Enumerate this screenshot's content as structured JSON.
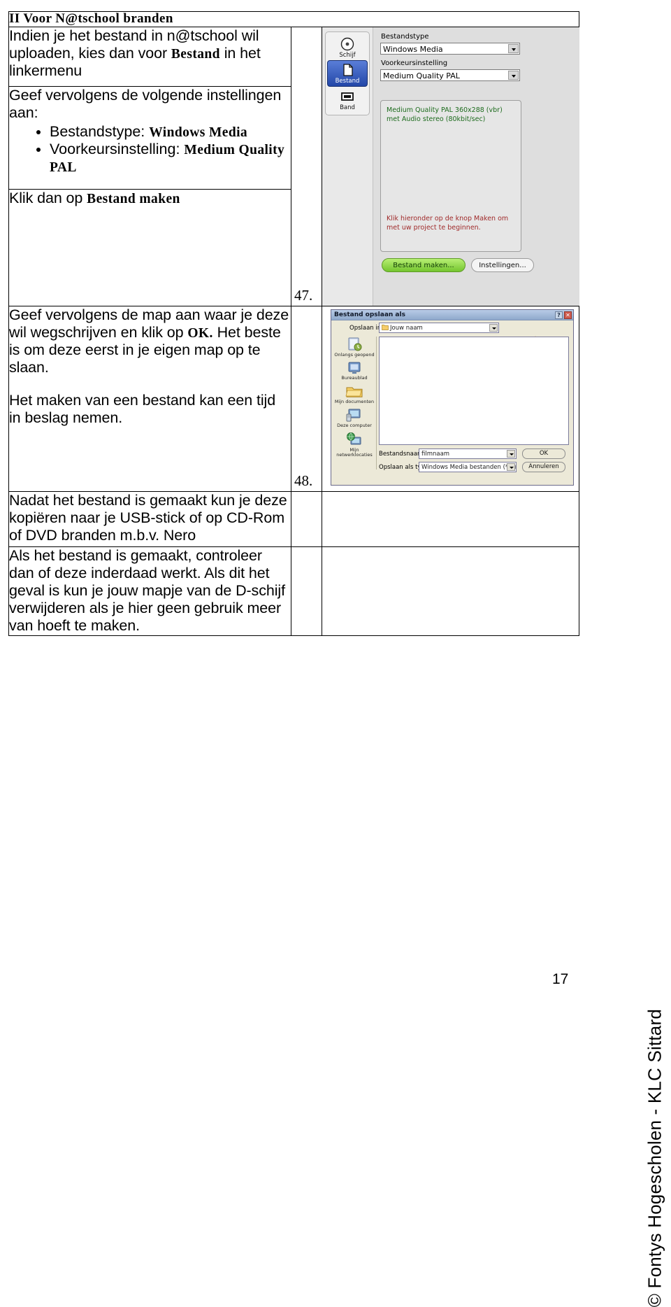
{
  "document": {
    "page_number": "17",
    "copyright": "© Fontys Hogescholen - KLC Sittard"
  },
  "table": {
    "header": "II Voor N@tschool branden",
    "rows": [
      {
        "id": "row-upload",
        "text_plain_1": "Indien je het bestand in n@tschool wil uploaden, kies dan voor ",
        "text_bold_1": "Bestand",
        "text_plain_2": " in het linkermenu"
      },
      {
        "id": "row-settings",
        "intro": "Geef vervolgens de volgende instellingen aan:",
        "bullets": [
          {
            "label": "Bestandstype: ",
            "value": "Windows Media"
          },
          {
            "label": "Voorkeursinstelling: ",
            "value": "Medium Quality PAL"
          }
        ]
      },
      {
        "id": "row-make",
        "text_plain_1": "Klik dan op ",
        "text_bold_1": "Bestand maken"
      },
      {
        "id": "row-folder",
        "text_plain_1": "Geef vervolgens de map aan waar je deze wil wegschrijven en klik op ",
        "text_bold_1": "OK.",
        "text_plain_2": " Het beste is om deze eerst in je eigen map op te slaan.",
        "paragraph_2": "Het maken van een bestand kan een tijd in beslag nemen."
      },
      {
        "id": "row-copy",
        "text_plain_1": "Nadat het bestand is gemaakt kun je deze kopiëren naar je USB-stick of op CD-Rom of DVD branden m.b.v. Nero"
      },
      {
        "id": "row-verify",
        "text_plain_1": "Als het bestand is gemaakt, controleer dan of deze inderdaad werkt. Als dit het geval is kun je jouw mapje van de D-schijf verwijderen als je hier geen gebruik meer van hoeft te maken."
      }
    ],
    "figure_numbers": {
      "first": "47.",
      "second": "48."
    }
  },
  "screenshot_nero": {
    "tabs": [
      {
        "name": "Schijf",
        "icon": "disc-icon",
        "selected": false
      },
      {
        "name": "Bestand",
        "icon": "file-icon",
        "selected": true
      },
      {
        "name": "Band",
        "icon": "tape-icon",
        "selected": false
      }
    ],
    "field_type_label": "Bestandstype",
    "field_type_value": "Windows Media",
    "field_preset_label": "Voorkeursinstelling",
    "field_preset_value": "Medium Quality PAL",
    "info_green": "Medium Quality PAL 360x288 (vbr) met Audio stereo (80kbit/sec)",
    "info_red": "Klik hieronder op de knop Maken om met uw project te beginnen.",
    "button_create": "Bestand maken...",
    "button_settings": "Instellingen...",
    "colors": {
      "create_button_green": "#74c52f",
      "info_green_text": "#1d6b1d",
      "info_red_text": "#a02b2b",
      "tab_selected_blue": "#2347a8"
    }
  },
  "screenshot_saveas": {
    "title": "Bestand opslaan als",
    "help_button": "?",
    "close_button": "✕",
    "save_in_label": "Opslaan in:",
    "save_in_value": "Jouw naam",
    "toolbar_icons": [
      "back-icon",
      "up-folder-icon",
      "new-folder-icon",
      "views-icon"
    ],
    "places": [
      {
        "label": "Onlangs geopend",
        "icon": "recent-documents-icon"
      },
      {
        "label": "Bureaublad",
        "icon": "desktop-icon"
      },
      {
        "label": "Mijn documenten",
        "icon": "my-documents-icon"
      },
      {
        "label": "Deze computer",
        "icon": "my-computer-icon"
      },
      {
        "label": "Mijn netwerklocaties",
        "icon": "network-places-icon"
      }
    ],
    "filename_label": "Bestandsnaam:",
    "filename_value": "filmnaam",
    "filetype_label": "Opslaan als type:",
    "filetype_value": "Windows Media bestanden (*.wmv)",
    "button_ok": "OK",
    "button_cancel": "Annuleren"
  }
}
